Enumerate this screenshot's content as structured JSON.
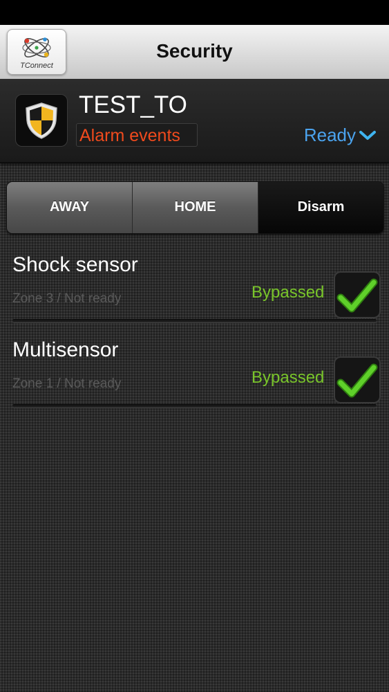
{
  "app": {
    "title": "Security",
    "logo_text": "TConnect"
  },
  "header": {
    "device_name": "TEST_TO",
    "alarm_events_label": "Alarm events",
    "status": "Ready"
  },
  "modes": {
    "items": [
      "AWAY",
      "HOME",
      "Disarm"
    ],
    "active": "Disarm"
  },
  "sensors": [
    {
      "name": "Shock sensor",
      "zone_status": "Zone 3 / Not ready",
      "bypass_label": "Bypassed",
      "bypassed": true
    },
    {
      "name": "Multisensor",
      "zone_status": "Zone 1 / Not ready",
      "bypass_label": "Bypassed",
      "bypassed": true
    }
  ],
  "colors": {
    "alarm_events": "#f04a1d",
    "ready_status": "#4ba3ee",
    "bypassed": "#79c52a",
    "shield_yellow": "#f2b51f"
  },
  "icons": {
    "logo": "tconnect-atom-logo",
    "security": "shield-icon",
    "status_dropdown": "chevron-down-icon",
    "bypass": "checkmark-icon"
  }
}
